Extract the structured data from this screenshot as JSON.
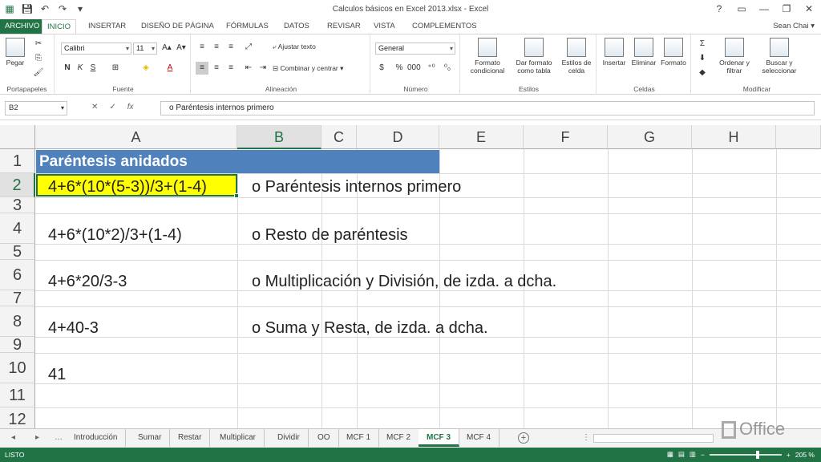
{
  "title": "Calculos básicos en Excel 2013.xlsx - Excel",
  "user": "Sean Chai",
  "window_controls": [
    "?",
    "▭",
    "—",
    "❐",
    "✕"
  ],
  "tabs": [
    {
      "label": "ARCHIVO"
    },
    {
      "label": "INICIO"
    },
    {
      "label": "INSERTAR"
    },
    {
      "label": "DISEÑO DE PÁGINA"
    },
    {
      "label": "FÓRMULAS"
    },
    {
      "label": "DATOS"
    },
    {
      "label": "REVISAR"
    },
    {
      "label": "VISTA"
    },
    {
      "label": "COMPLEMENTOS"
    }
  ],
  "ribbon": {
    "clipboard": {
      "paste": "Pegar",
      "group": "Portapapeles"
    },
    "font": {
      "name": "Calibri",
      "size": "11",
      "bold": "N",
      "italic": "K",
      "underline": "S",
      "group": "Fuente"
    },
    "alignment": {
      "wrap": "Ajustar texto",
      "merge": "Combinar y centrar",
      "group": "Alineación"
    },
    "number": {
      "format": "General",
      "group": "Número"
    },
    "styles": {
      "cond": "Formato condicional",
      "table": "Dar formato como tabla",
      "cell": "Estilos de celda",
      "group": "Estilos"
    },
    "cells": {
      "insert": "Insertar",
      "delete": "Eliminar",
      "format": "Formato",
      "group": "Celdas"
    },
    "modify": {
      "sort": "Ordenar y filtrar",
      "find": "Buscar y seleccionar",
      "group": "Modificar"
    }
  },
  "formula_bar": {
    "name_box": "B2",
    "content": "o Paréntesis internos primero"
  },
  "columns": [
    "A",
    "B",
    "C",
    "D",
    "E",
    "F",
    "G",
    "H"
  ],
  "rows": [
    "1",
    "2",
    "3",
    "4",
    "5",
    "6",
    "7",
    "8",
    "9",
    "10",
    "11",
    "12"
  ],
  "cells": {
    "A1": "Paréntesis anidados",
    "A2": "4+6*(10*(5-3))/3+(1-4)",
    "B2": "o Paréntesis internos primero",
    "A4": "4+6*(10*2)/3+(1-4)",
    "B4": "o Resto de paréntesis",
    "A6": "4+6*20/3-3",
    "B6": "o Multiplicación y División, de izda. a dcha.",
    "A8": "4+40-3",
    "B8": "o Suma y Resta, de izda. a dcha.",
    "A10": "41"
  },
  "sheets": [
    "Introducción",
    "Sumar",
    "Restar",
    "Multiplicar",
    "Dividir",
    "OO",
    "MCF 1",
    "MCF 2",
    "MCF 3",
    "MCF 4"
  ],
  "active_sheet": "MCF 3",
  "status": "LISTO",
  "zoom": "205 %",
  "office_brand": "Office",
  "colors": {
    "excel_green": "#217346",
    "title_fill": "#4f81bd",
    "highlight": "#ffff00"
  }
}
